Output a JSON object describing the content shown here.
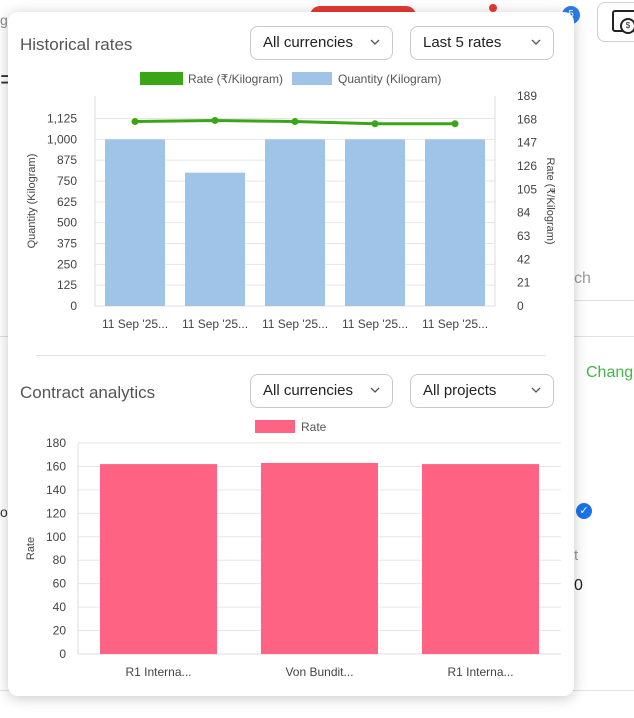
{
  "background": {
    "left_fragment_1": "g",
    "left_fragment_2": "=",
    "right_fragment_search": "ch",
    "right_fragment_change": "Chang",
    "left_fragment_3": "o",
    "right_fragment_t": "t",
    "right_fragment_0": "0",
    "badge_count": "5",
    "wallet_symbol": "$"
  },
  "historical": {
    "title": "Historical rates",
    "currency_select": "All currencies",
    "range_select": "Last 5 rates"
  },
  "contract": {
    "title": "Contract analytics",
    "currency_select": "All currencies",
    "project_select": "All projects"
  },
  "chart_data": [
    {
      "type": "bar",
      "categories": [
        "11 Sep '25...",
        "11 Sep '25...",
        "11 Sep '25...",
        "11 Sep '25...",
        "11 Sep '25..."
      ],
      "series": [
        {
          "name": "Quantity (Kilogram)",
          "type": "bar",
          "axis": "left",
          "color": "#a0c4e8",
          "values": [
            1000,
            800,
            1000,
            1000,
            1000
          ]
        },
        {
          "name": "Rate (₹/Kilogram)",
          "type": "line",
          "axis": "right",
          "color": "#3aa517",
          "values": [
            166,
            167,
            166,
            164,
            164
          ]
        }
      ],
      "ylabel": "Quantity (Kilogram)",
      "y2label": "Rate (₹/Kilogram)",
      "ylim": [
        0,
        1260
      ],
      "y2lim": [
        0,
        189
      ],
      "yticks": [
        "0",
        "125",
        "250",
        "375",
        "500",
        "625",
        "750",
        "875",
        "1,000",
        "1,125"
      ],
      "y2ticks": [
        "0",
        "21",
        "42",
        "63",
        "84",
        "105",
        "126",
        "147",
        "168",
        "189"
      ],
      "grid": true,
      "legend_position": "top"
    },
    {
      "type": "bar",
      "categories": [
        "R1 Interna...",
        "Von Bundit...",
        "R1 Interna..."
      ],
      "series": [
        {
          "name": "Rate",
          "color": "#ff6384",
          "values": [
            162,
            163,
            162
          ]
        }
      ],
      "ylabel": "Rate",
      "ylim": [
        0,
        180
      ],
      "yticks": [
        "0",
        "20",
        "40",
        "60",
        "80",
        "100",
        "120",
        "140",
        "160",
        "180"
      ],
      "grid": true,
      "legend_position": "top"
    }
  ]
}
